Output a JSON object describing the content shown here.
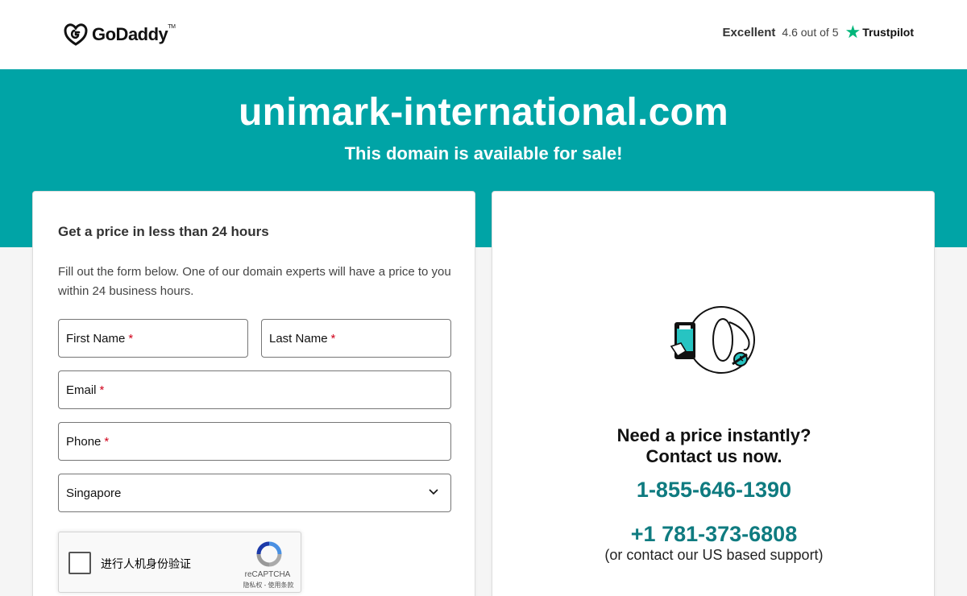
{
  "header": {
    "brand": "GoDaddy",
    "brand_mark": "TM",
    "trustpilot": {
      "rating_word": "Excellent",
      "score": "4.6 out of 5",
      "name": "Trustpilot",
      "star_color": "#00b67a"
    }
  },
  "hero": {
    "domain": "unimark-international.com",
    "subtitle": "This domain is available for sale!",
    "bg_color": "#00a4a6"
  },
  "form": {
    "title": "Get a price in less than 24 hours",
    "description": "Fill out the form below. One of our domain experts will have a price to you within 24 business hours.",
    "first_name": "First Name",
    "last_name": "Last Name",
    "email": "Email",
    "phone": "Phone",
    "required_mark": "*",
    "country": "Singapore",
    "captcha": {
      "label": "进行人机身份验证",
      "brand": "reCAPTCHA",
      "terms": "隐私权 - 使用条款"
    }
  },
  "contact": {
    "heading_line1": "Need a price instantly?",
    "heading_line2": "Contact us now.",
    "phone_primary": "1-855-646-1390",
    "phone_secondary": "+1 781-373-6808",
    "note": "(or contact our US based support)",
    "phone_color": "#0f7b80"
  }
}
